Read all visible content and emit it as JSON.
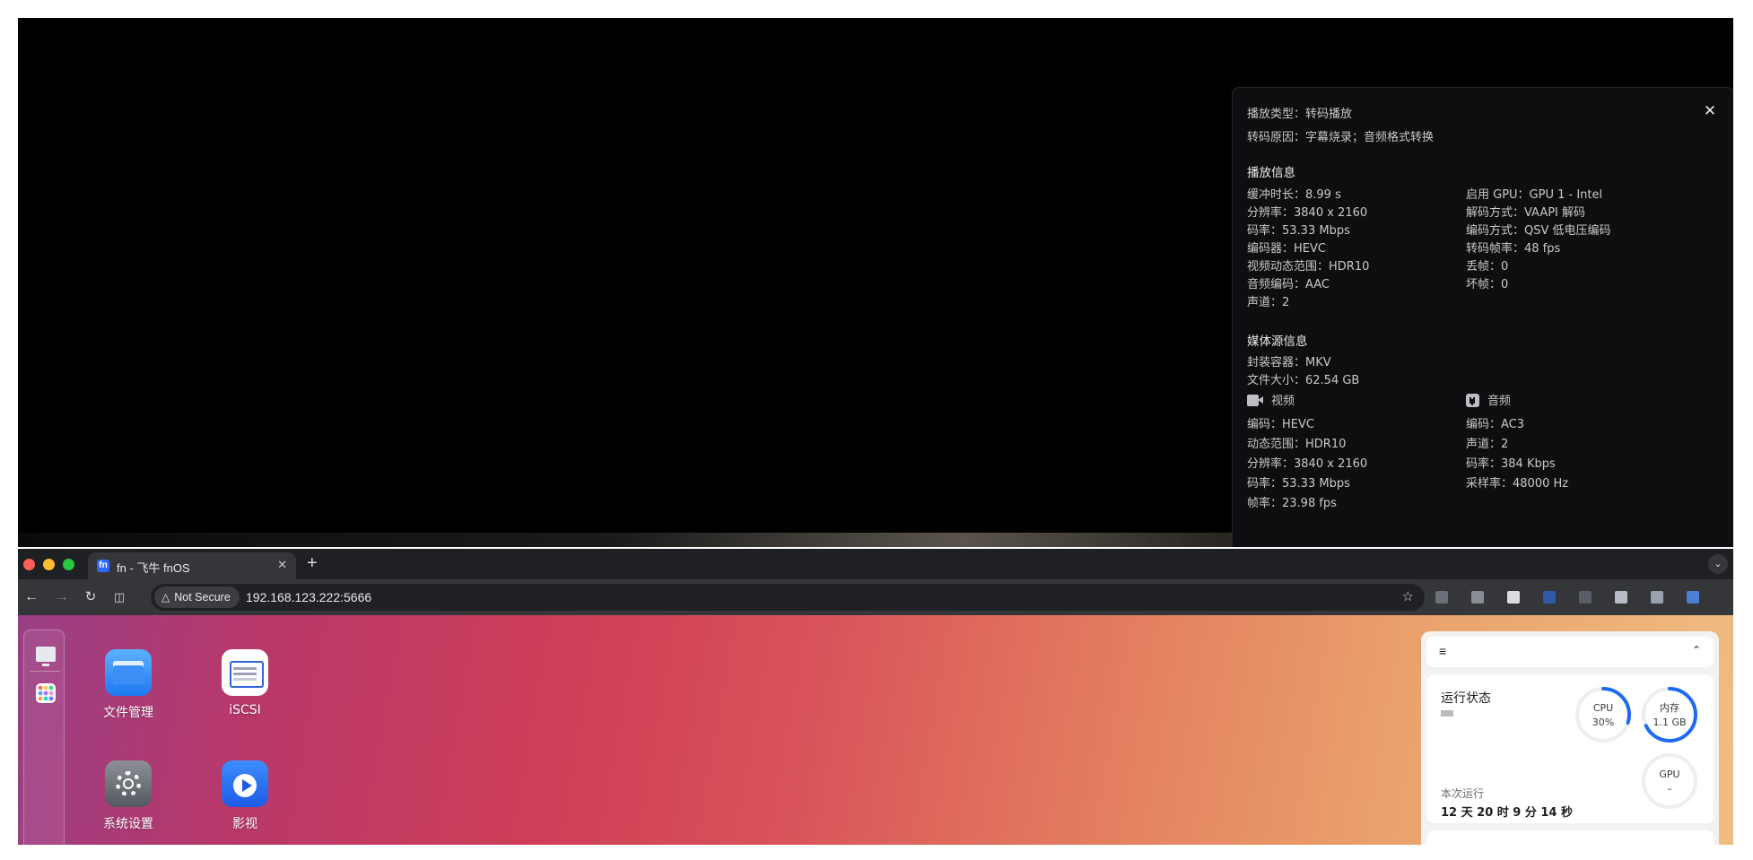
{
  "player": {
    "close_symbol": "✕",
    "play_type": "播放类型：转码播放",
    "transcode_reason": "转码原因：字幕烧录；音频格式转换",
    "playback_heading": "播放信息",
    "playback_left": [
      "缓冲时长：8.99 s",
      "分辨率：3840 x 2160",
      "码率：53.33 Mbps",
      "编码器：HEVC",
      "视频动态范围：HDR10",
      "音频编码：AAC",
      "声道：2"
    ],
    "playback_right": [
      "启用 GPU：GPU 1 - Intel",
      "解码方式：VAAPI 解码",
      "编码方式：QSV 低电压编码",
      "转码帧率：48 fps",
      "丢帧：0",
      "坏帧：0"
    ],
    "source_heading": "媒体源信息",
    "container": "封装容器：MKV",
    "file_size": "文件大小：62.54 GB",
    "video_label": "视频",
    "audio_label": "音频",
    "video_props": [
      "编码：HEVC",
      "动态范围：HDR10",
      "分辨率：3840 x 2160",
      "码率：53.33 Mbps",
      "帧率：23.98 fps"
    ],
    "audio_props": [
      "编码：AC3",
      "声道：2",
      "码率：384 Kbps",
      "采样率：48000 Hz"
    ]
  },
  "browser": {
    "tab_title": "fn - 飞牛 fnOS",
    "tab_close": "✕",
    "new_tab": "+",
    "tab_search": "⌄",
    "back": "←",
    "forward": "→",
    "reload": "↻",
    "split": "◫",
    "security_warning": "△",
    "security_label": "Not Secure",
    "url": "192.168.123.222:5666",
    "bookmark": "☆",
    "extension_colors": [
      "#6b6f78",
      "#8a8d94",
      "#d9dbe0",
      "#2e5aa8",
      "#5a5d66",
      "#b8bcc6",
      "#9aa2b2",
      "#4a7fd6"
    ]
  },
  "desktop": {
    "apps": [
      {
        "label": "文件管理"
      },
      {
        "label": "iSCSI"
      },
      {
        "label": "系统设置"
      },
      {
        "label": "影视"
      }
    ],
    "widget": {
      "list_symbol": "≡",
      "collapse_symbol": "⌃",
      "title": "运行状态",
      "cpu_label": "CPU",
      "cpu_value": "30%",
      "cpu_fraction": 0.3,
      "mem_label": "内存",
      "mem_value": "1.1 GB",
      "mem_fraction": 0.68,
      "gpu_label": "GPU",
      "gpu_value": "–",
      "gpu_fraction": 0,
      "accent": "#1e6bf2",
      "uptime_label": "本次运行",
      "uptime_value": "12 天 20 时 9 分 14 秒"
    }
  }
}
